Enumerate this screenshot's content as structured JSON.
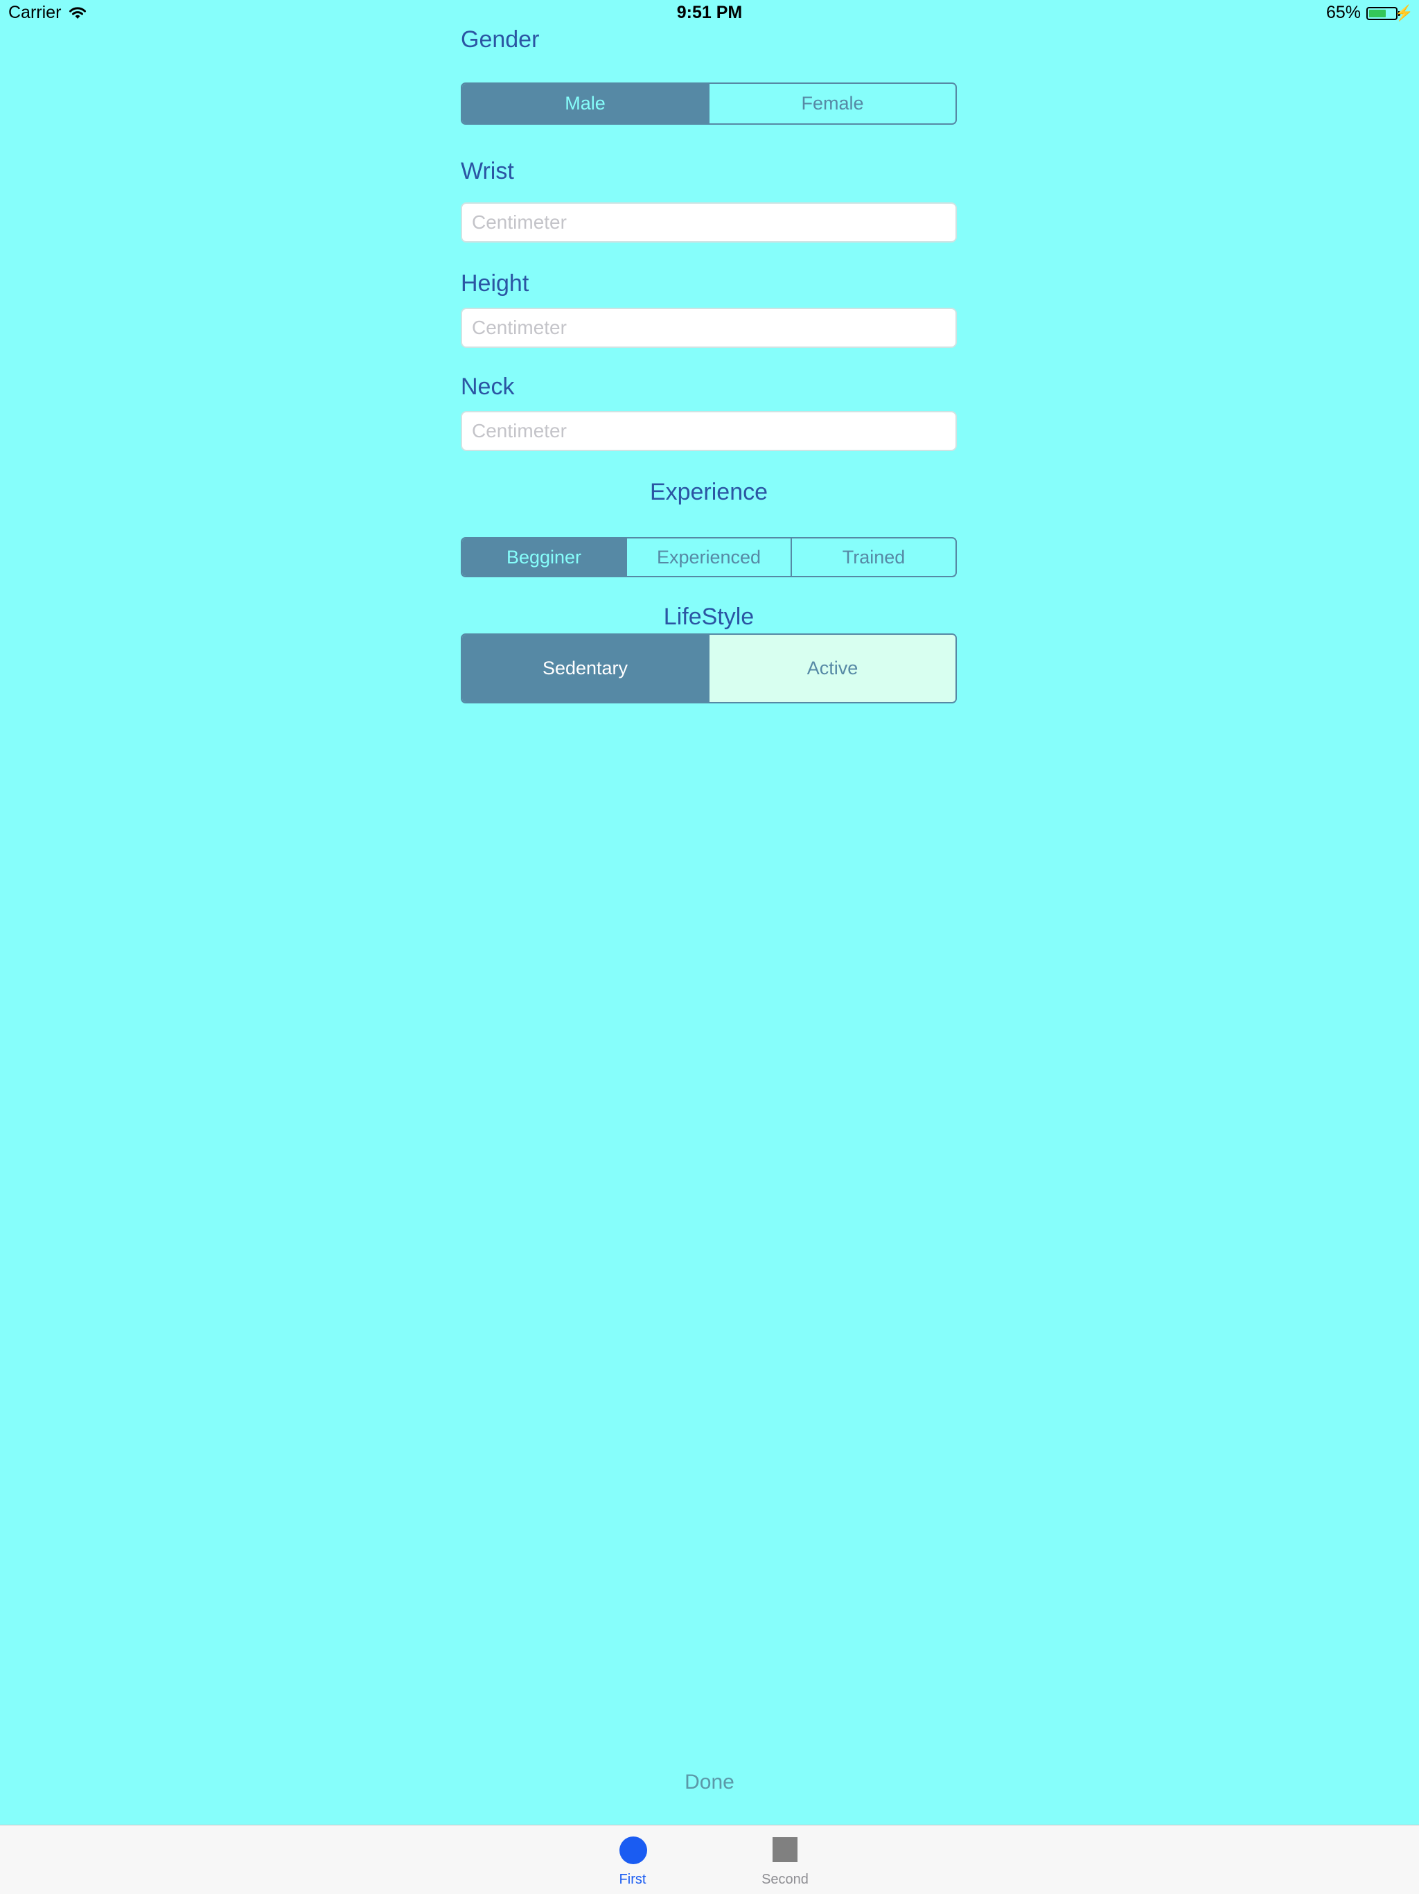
{
  "status_bar": {
    "carrier": "Carrier",
    "time": "9:51 PM",
    "battery_percent": "65%",
    "battery_level": 0.65
  },
  "gender": {
    "label": "Gender",
    "options": [
      "Male",
      "Female"
    ],
    "selected": "Male"
  },
  "wrist": {
    "label": "Wrist",
    "placeholder": "Centimeter",
    "value": ""
  },
  "height": {
    "label": "Height",
    "placeholder": "Centimeter",
    "value": ""
  },
  "neck": {
    "label": "Neck",
    "placeholder": "Centimeter",
    "value": ""
  },
  "experience": {
    "label": "Experience",
    "options": [
      "Begginer",
      "Experienced",
      "Trained"
    ],
    "selected": "Begginer"
  },
  "lifestyle": {
    "label": "LifeStyle",
    "options": [
      "Sedentary",
      "Active"
    ],
    "selected": "Sedentary"
  },
  "done_label": "Done",
  "tabbar": {
    "items": [
      {
        "label": "First",
        "icon": "circle-icon",
        "selected": true
      },
      {
        "label": "Second",
        "icon": "square-icon",
        "selected": false
      }
    ]
  },
  "colors": {
    "background": "#86FEFB",
    "accent": "#5689A5",
    "label_text": "#2B55A3",
    "tab_selected": "#1A5CF2",
    "active_option_bg": "#D8FFF0"
  }
}
